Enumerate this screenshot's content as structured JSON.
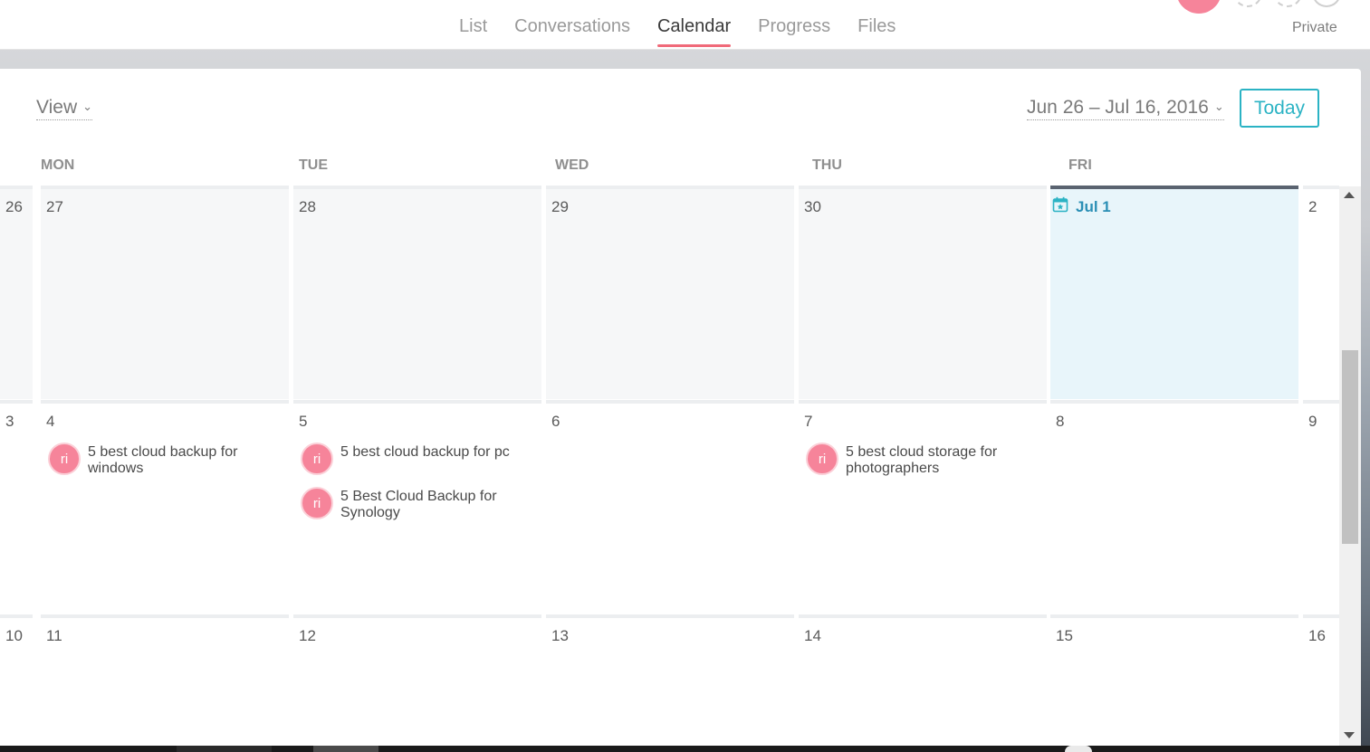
{
  "nav": {
    "tabs": [
      {
        "label": "List",
        "active": false
      },
      {
        "label": "Conversations",
        "active": false
      },
      {
        "label": "Calendar",
        "active": true
      },
      {
        "label": "Progress",
        "active": false
      },
      {
        "label": "Files",
        "active": false
      }
    ],
    "privacy_label": "Private"
  },
  "toolbar": {
    "view_label": "View",
    "range_label": "Jun 26 – Jul 16, 2016",
    "today_label": "Today"
  },
  "weekdays": [
    "MON",
    "TUE",
    "WED",
    "THU",
    "FRI"
  ],
  "weeks": [
    {
      "sun": "26",
      "days": [
        "27",
        "28",
        "29",
        "30",
        "Jul 1"
      ],
      "sat": "2"
    },
    {
      "sun": "3",
      "days": [
        "4",
        "5",
        "6",
        "7",
        "8"
      ],
      "sat": "9"
    },
    {
      "sun": "10",
      "days": [
        "11",
        "12",
        "13",
        "14",
        "15"
      ],
      "sat": "16"
    }
  ],
  "tasks": {
    "mon_4": [
      {
        "avatar": "ri",
        "title": "5 best cloud backup for windows"
      }
    ],
    "tue_5": [
      {
        "avatar": "ri",
        "title": "5 best cloud backup for pc"
      },
      {
        "avatar": "ri",
        "title": "5 Best Cloud Backup for Synology"
      }
    ],
    "thu_7": [
      {
        "avatar": "ri",
        "title": "5 best cloud storage for photographers"
      }
    ]
  },
  "colors": {
    "accent": "#2bb3c4",
    "tab_underline": "#f06a79",
    "avatar": "#f6849a",
    "today_bg": "#e8f5fa"
  }
}
